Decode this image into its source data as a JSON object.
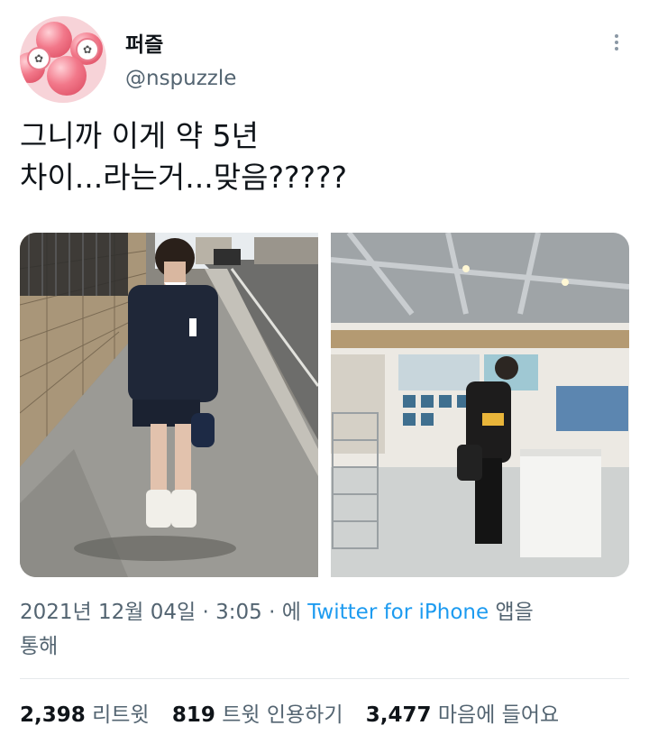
{
  "author": {
    "display_name": "퍼즐",
    "handle": "@nspuzzle",
    "avatar_icon": "pink-balls-avatar"
  },
  "tweet": {
    "line1": "그니까 이게 약 5년",
    "line2": "차이...라는거...맞음?????"
  },
  "media": {
    "left_photo": "photo-boy-school-uniform-street",
    "right_photo": "photo-man-in-record-store"
  },
  "meta": {
    "date": "2021년 12월 04일",
    "separator": "·",
    "time": "3:05",
    "prefix": "에",
    "source": "Twitter for iPhone",
    "suffix": "앱을",
    "line2": "통해"
  },
  "stats": {
    "retweets_count": "2,398",
    "retweets_label": "리트윗",
    "quotes_count": "819",
    "quotes_label": "트윗 인용하기",
    "likes_count": "3,477",
    "likes_label": "마음에 들어요"
  },
  "colors": {
    "link": "#1d9bf0",
    "secondary_text": "#536471",
    "primary_text": "#0f1419"
  }
}
